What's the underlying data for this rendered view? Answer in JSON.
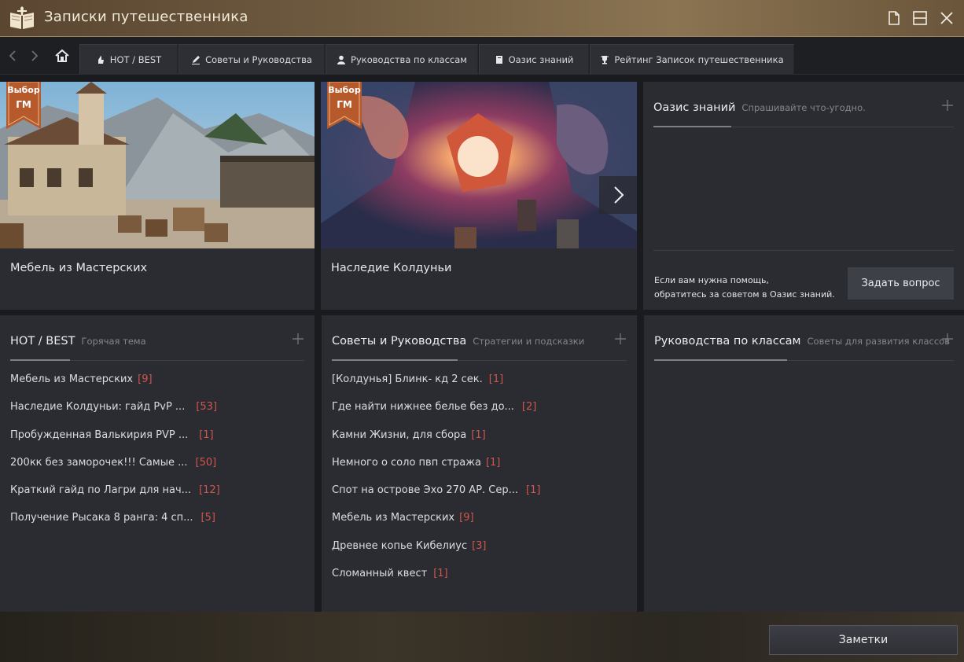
{
  "window": {
    "title": "Записки путешественника",
    "accent": "#8a7452"
  },
  "nav": {
    "tabs": [
      {
        "label": "HOT / BEST",
        "icon": "hand-icon"
      },
      {
        "label": "Советы и Руководства",
        "icon": "pen-icon"
      },
      {
        "label": "Руководства по классам",
        "icon": "user-icon"
      },
      {
        "label": "Оазис знаний",
        "icon": "book-icon"
      },
      {
        "label": "Рейтинг Записок путешественника",
        "icon": "trophy-icon"
      }
    ]
  },
  "featured": [
    {
      "badge_line1": "Выбор",
      "badge_line2": "ГМ",
      "caption": "Мебель из Мастерских"
    },
    {
      "badge_line1": "Выбор",
      "badge_line2": "ГМ",
      "caption": "Наследие Колдуньи"
    }
  ],
  "oasis": {
    "title": "Оазис знаний",
    "subtitle": "Спрашивайте что-угодно.",
    "help_line1": "Если вам нужна помощь,",
    "help_line2": "обратитесь за советом в Оазис знаний.",
    "ask_button": "Задать вопрос"
  },
  "hot": {
    "title": "HOT / BEST",
    "subtitle": "Горячая тема",
    "items": [
      {
        "text": "Мебель из Мастерских",
        "count": "[9]"
      },
      {
        "text": "Наследие Колдуньи: гайд PvP ...",
        "count": "[53]"
      },
      {
        "text": "Пробужденная Валькирия PVP ...",
        "count": "[1]"
      },
      {
        "text": "200кк без заморочек!!! Самые ...",
        "count": "[50]"
      },
      {
        "text": "Краткий гайд по Лагри для нач...",
        "count": "[12]"
      },
      {
        "text": "Получение Рысака 8 ранга: 4 сп...",
        "count": "[5]"
      }
    ]
  },
  "guides": {
    "title": "Советы и Руководства",
    "subtitle": "Стратегии и подсказки",
    "items": [
      {
        "text": "[Колдунья] Блинк- кд 2 сек.",
        "count": "[1]"
      },
      {
        "text": "Где найти нижнее белье без до...",
        "count": "[2]"
      },
      {
        "text": "Камни Жизни, для сбора",
        "count": "[1]"
      },
      {
        "text": "Немного о соло пвп стража",
        "count": "[1]"
      },
      {
        "text": "Спот на острове Эхо 270 АР. Сер...",
        "count": "[1]"
      },
      {
        "text": "Мебель из Мастерских",
        "count": "[9]"
      },
      {
        "text": "Древнее копье Кибелиус",
        "count": "[3]"
      },
      {
        "text": "Сломанный квест",
        "count": "[1]"
      }
    ]
  },
  "classes": {
    "title": "Руководства по классам",
    "subtitle": "Советы для развития классов"
  },
  "footer": {
    "notes_button": "Заметки"
  }
}
